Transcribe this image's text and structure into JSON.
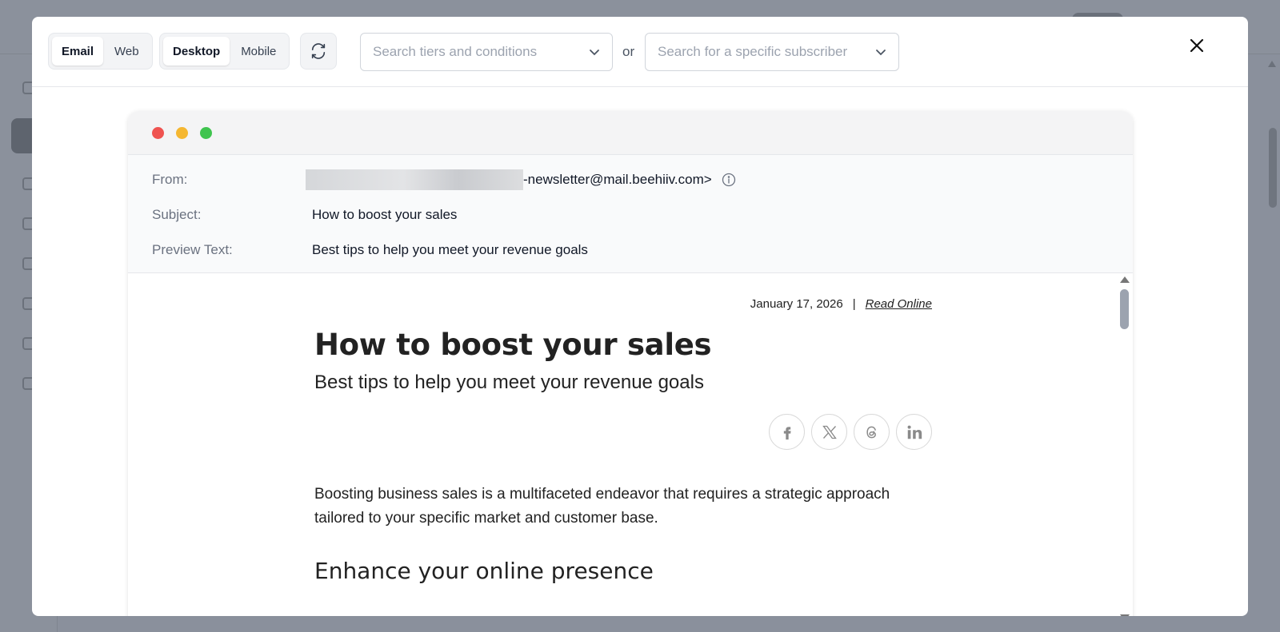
{
  "toolbar": {
    "view_tabs": [
      {
        "label": "Email",
        "active": true
      },
      {
        "label": "Web",
        "active": false
      }
    ],
    "device_tabs": [
      {
        "label": "Desktop",
        "active": true
      },
      {
        "label": "Mobile",
        "active": false
      }
    ],
    "refresh_icon": "refresh-icon",
    "tiers_search": {
      "placeholder": "Search tiers and conditions"
    },
    "or_label": "or",
    "subscriber_search": {
      "placeholder": "Search for a specific subscriber"
    },
    "close_icon": "close-icon"
  },
  "window": {
    "dots": [
      "#ef5350",
      "#f5b731",
      "#3fc44e"
    ]
  },
  "meta": {
    "from_label": "From:",
    "from_value": "-newsletter@mail.beehiiv.com>",
    "subject_label": "Subject:",
    "subject_value": "How to boost your sales",
    "preview_label": "Preview Text:",
    "preview_value": "Best tips to help you meet your revenue goals"
  },
  "email": {
    "date": "January 17, 2026",
    "separator": "|",
    "read_online": "Read Online",
    "title": "How to boost your sales",
    "subtitle": "Best tips to help you meet your revenue goals",
    "socials": [
      "facebook-icon",
      "x-icon",
      "threads-icon",
      "linkedin-icon"
    ],
    "paragraph": "Boosting business sales is a multifaceted endeavor that requires a strategic approach tailored to your specific market and customer base.",
    "heading2": "Enhance your online presence"
  }
}
